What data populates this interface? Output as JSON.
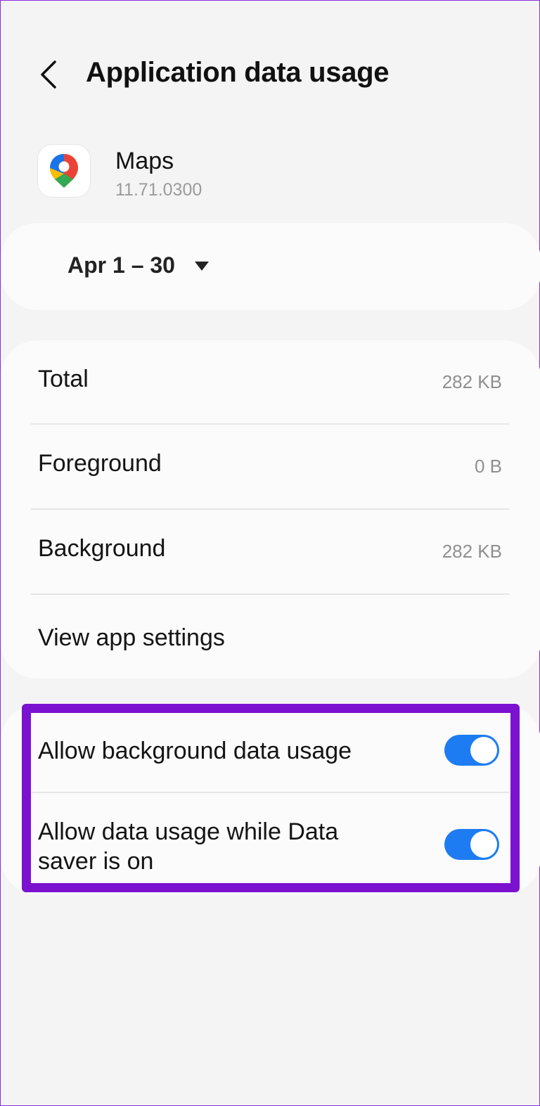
{
  "header": {
    "title": "Application data usage",
    "back_icon": "chevron-left-icon"
  },
  "app": {
    "name": "Maps",
    "version": "11.71.0300",
    "icon": "google-maps-pin-icon"
  },
  "date_range": {
    "label": "Apr 1 – 30",
    "caret_icon": "caret-down-icon"
  },
  "usage": {
    "total_label": "Total",
    "total_value": "282 KB",
    "foreground_label": "Foreground",
    "foreground_value": "0 B",
    "background_label": "Background",
    "background_value": "282 KB",
    "settings_label": "View app settings"
  },
  "toggles": {
    "background_data_label": "Allow background data usage",
    "background_data_on": true,
    "data_saver_label_line1": "Allow data usage while Data",
    "data_saver_label_line2": "saver is on",
    "data_saver_on": true
  },
  "colors": {
    "accent": "#1d7cf2",
    "highlight": "#7b12cf",
    "background": "#f4f4f4",
    "card": "#fbfbfb"
  }
}
